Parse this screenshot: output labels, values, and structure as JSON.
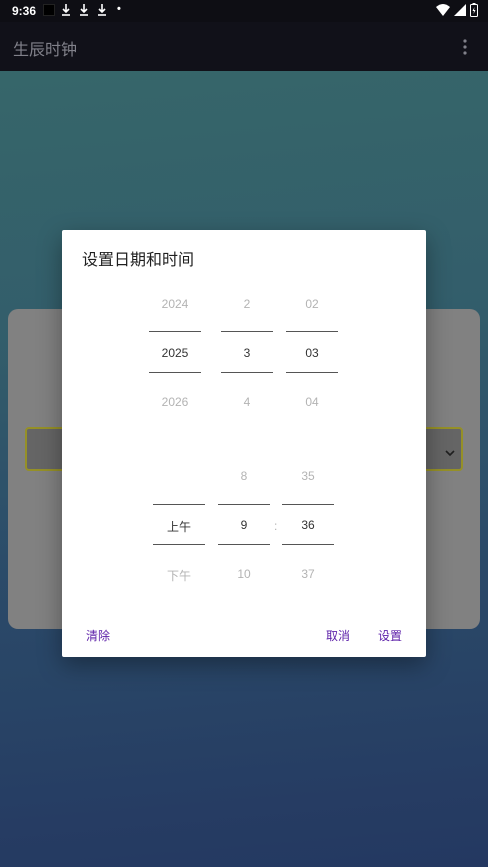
{
  "status_bar": {
    "time": "9:36",
    "dot": "•",
    "icons": [
      "download-icon",
      "download-icon",
      "download-icon",
      "wifi-icon",
      "signal-icon",
      "battery-charging-icon"
    ]
  },
  "app_bar": {
    "title": "生辰时钟",
    "menu_icon": "more-vert-icon"
  },
  "dialog": {
    "title": "设置日期和时间",
    "date_picker": {
      "year": {
        "prev": "2024",
        "current": "2025",
        "next": "2026"
      },
      "month": {
        "prev": "2",
        "current": "3",
        "next": "4"
      },
      "day": {
        "prev": "02",
        "current": "03",
        "next": "04"
      }
    },
    "time_picker": {
      "ampm": {
        "prev": "",
        "current": "上午",
        "next": "下午"
      },
      "hour": {
        "prev": "8",
        "current": "9",
        "next": "10"
      },
      "separator": ":",
      "minute": {
        "prev": "35",
        "current": "36",
        "next": "37"
      }
    },
    "buttons": {
      "clear": "清除",
      "cancel": "取消",
      "set": "设置"
    }
  },
  "colors": {
    "accent": "#5b1ea8",
    "select_border": "#a29d2b"
  }
}
